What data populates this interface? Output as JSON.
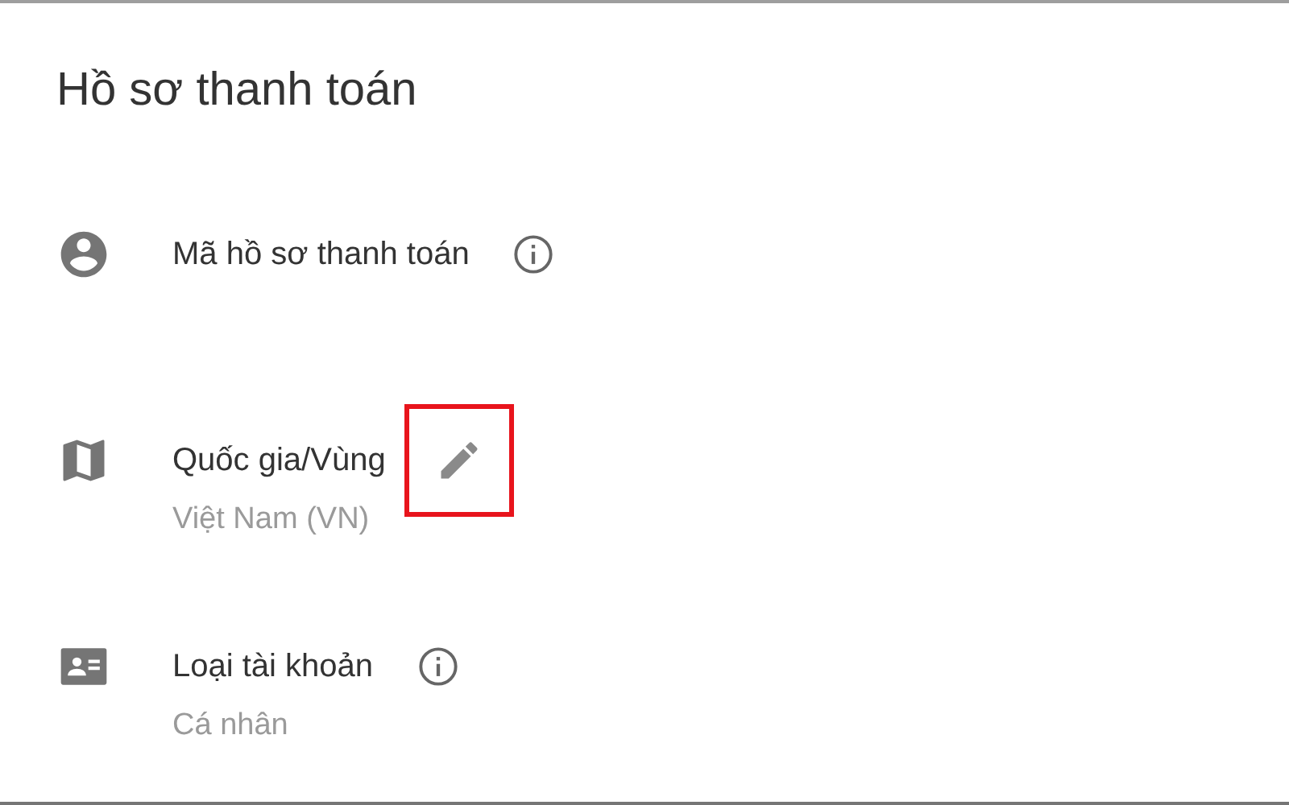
{
  "title": "Hồ sơ thanh toán",
  "fields": [
    {
      "label": "Mã hồ sơ thanh toán",
      "kind": "info",
      "highlighted": false
    },
    {
      "label": "Quốc gia/Vùng",
      "kind": "edit",
      "highlighted": true,
      "value": "Việt Nam (VN)"
    },
    {
      "label": "Loại tài khoản",
      "kind": "info",
      "highlighted": false,
      "value": "Cá nhân"
    }
  ]
}
